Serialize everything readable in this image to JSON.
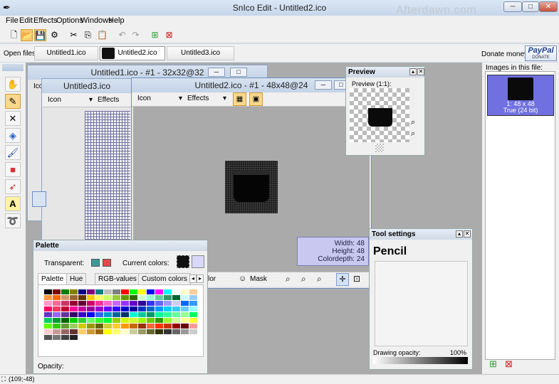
{
  "app": {
    "title": "SnIco Edit - Untitled2.ico",
    "watermark": "Afterdawn.com"
  },
  "window_controls": {
    "minimize": "─",
    "maximize": "□",
    "close": "✕"
  },
  "menu": [
    "File",
    "Edit",
    "Effects",
    "Options",
    "Windows",
    "Help"
  ],
  "toolbar": {
    "icons": [
      "new-file",
      "open-file",
      "save-file",
      "properties",
      "cut",
      "copy",
      "paste",
      "undo",
      "redo",
      "add-image",
      "delete-image"
    ]
  },
  "open_files": {
    "label": "Open files:",
    "tabs": [
      "Untitled1.ico",
      "Untitled2.ico",
      "Untitled3.ico"
    ],
    "active": 1
  },
  "donate": {
    "label": "Donate money:",
    "paypal": "PayPal",
    "donate_text": "DONATE"
  },
  "left_tools": [
    "hand-icon",
    "pencil-icon",
    "color-picker-icon",
    "fill-bucket-icon",
    "brush-icon",
    "shape-icon",
    "spray-icon",
    "text-icon",
    "lasso-icon"
  ],
  "left_tools_text": {
    "text_tool": "A"
  },
  "windows": {
    "w1": {
      "title": "Untitled1.ico - #1 - 32x32@32",
      "icon_menu": "Icon"
    },
    "w3": {
      "title": "Untitled3.ico",
      "icon_menu": "Icon",
      "effects_menu": "Effects"
    },
    "w2": {
      "title": "Untitled2.ico - #1 - 48x48@24",
      "icon_menu": "Icon",
      "effects_menu": "Effects",
      "bottom_color": "lor",
      "mask": "Mask",
      "info": {
        "width": "Width: 48",
        "height": "Height: 48",
        "colordepth": "Colordepth: 24"
      }
    }
  },
  "preview": {
    "title": "Preview",
    "label": "Preview (1:1):"
  },
  "palette": {
    "title": "Palette",
    "transparent_label": "Transparent:",
    "current_label": "Current colors:",
    "tabs": [
      "Palette",
      "Hue",
      "RGB-values",
      "Custom colors"
    ],
    "opacity_label": "Opacity:",
    "colors": [
      "#000000",
      "#800000",
      "#008000",
      "#808000",
      "#000080",
      "#800080",
      "#008080",
      "#c0c0c0",
      "#808080",
      "#ff0000",
      "#00ff00",
      "#ffff00",
      "#0000ff",
      "#ff00ff",
      "#00ffff",
      "#ffffff",
      "#ffffcc",
      "#ffcc99",
      "#ff9933",
      "#ff6600",
      "#cc9966",
      "#996633",
      "#663300",
      "#ffcc00",
      "#ffff66",
      "#ccff66",
      "#99cc33",
      "#669900",
      "#336600",
      "#ccffcc",
      "#99ffcc",
      "#66cc99",
      "#339966",
      "#006633",
      "#ccffff",
      "#99ccff",
      "#ff99cc",
      "#ff6699",
      "#cc3366",
      "#990033",
      "#660033",
      "#cc0066",
      "#ff3399",
      "#ff66cc",
      "#cc66ff",
      "#9933ff",
      "#6600cc",
      "#330099",
      "#3333ff",
      "#6666ff",
      "#9999ff",
      "#ccccff",
      "#0066ff",
      "#3399ff",
      "#ff0066",
      "#ff3366",
      "#cc0033",
      "#ff0099",
      "#cc0099",
      "#990099",
      "#9900cc",
      "#6600ff",
      "#3300ff",
      "#0000cc",
      "#000099",
      "#0033cc",
      "#0066cc",
      "#0099ff",
      "#00ccff",
      "#33ccff",
      "#66ccff",
      "#99ffff",
      "#6633cc",
      "#9966ff",
      "#663399",
      "#330066",
      "#3300cc",
      "#0000ff",
      "#3366ff",
      "#0099cc",
      "#006699",
      "#003366",
      "#00ffcc",
      "#00cc99",
      "#009966",
      "#00ff99",
      "#33ff99",
      "#66ff99",
      "#99ff99",
      "#00ff66",
      "#00cc66",
      "#009933",
      "#006600",
      "#00cc00",
      "#33cc33",
      "#66ff66",
      "#33ff33",
      "#00ff33",
      "#99cc00",
      "#ccff00",
      "#ccff33",
      "#99ff00",
      "#66cc00",
      "#339900",
      "#99ff33",
      "#ccff99",
      "#ffff99",
      "#ffff33",
      "#66ff00",
      "#33cc00",
      "#669933",
      "#99cc66",
      "#cccc00",
      "#999900",
      "#666600",
      "#cccc33",
      "#ffcc33",
      "#ff9900",
      "#cc6600",
      "#993300",
      "#ff6633",
      "#ff3300",
      "#cc3300",
      "#990000",
      "#660000",
      "#ff9999",
      "#ffcccc",
      "#cc9999",
      "#996666",
      "#663333",
      "#ffcc66",
      "#cc9933",
      "#996600",
      "#ffff00",
      "#ffff66",
      "#ffffcc",
      "#cccc99",
      "#999966",
      "#666633",
      "#333300",
      "#333333",
      "#666666",
      "#999999",
      "#cccccc",
      "#555555",
      "#777777",
      "#444444",
      "#222222"
    ]
  },
  "tool_settings": {
    "title": "Tool settings",
    "tool_name": "Pencil",
    "opacity_label": "Drawing opacity:",
    "opacity_value": "100%",
    "opacity": 1.0
  },
  "images_panel": {
    "title": "Images in this file:",
    "item_size": "1: 48 x 48",
    "item_depth": "True (24 bit)"
  },
  "status": {
    "coords": "(109;-48)"
  },
  "colors": {
    "accent": "#7070e0",
    "mdi_bg": "#ababab",
    "info_bg": "#c8c8f0"
  }
}
